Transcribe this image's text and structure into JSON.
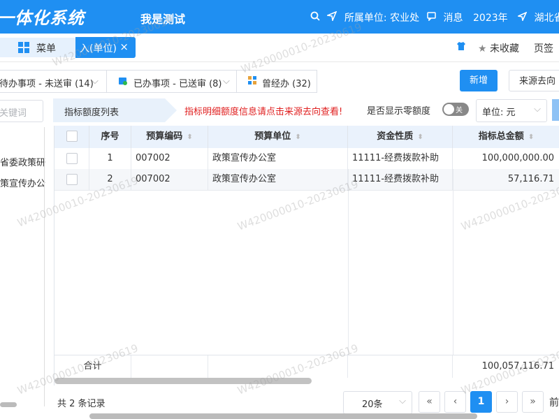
{
  "header": {
    "title": "一体化系统",
    "user_name": "我是测试",
    "unit_label": "所属单位: 农业处",
    "messages": "消息",
    "year": "2023年",
    "region": "湖北省"
  },
  "tabbar": {
    "menu_label": "菜单",
    "active_tab_label": "入(单位)",
    "close_icon": "×",
    "favorite_label": "未收藏",
    "page_sign": "页签"
  },
  "filters": {
    "tabs": [
      {
        "label": "待办事项 - 未送审 (14)"
      },
      {
        "label": "已办事项 - 已送审 (8)"
      },
      {
        "label": "曾经办 (32)"
      }
    ],
    "new_button": "新增",
    "source_button": "来源去向"
  },
  "left_panel": {
    "search_placeholder": "关键词",
    "tree_items": [
      "省委政策研",
      "策宣传办公"
    ]
  },
  "toolbar": {
    "list_title": "指标额度列表",
    "tip": "指标明细额度信息请点击来源去向查看!",
    "zero_label": "是否显示零额度",
    "toggle_text": "关",
    "unit_label": "单位:",
    "unit_value": "元"
  },
  "table": {
    "columns": [
      "序号",
      "预算编码",
      "预算单位",
      "资金性质",
      "指标总金额"
    ],
    "rows": [
      {
        "no": "1",
        "code": "007002",
        "unit": "政策宣传办公室",
        "fund": "11111-经费拨款补助",
        "amount": "100,000,000.00"
      },
      {
        "no": "2",
        "code": "007002",
        "unit": "政策宣传办公室",
        "fund": "11111-经费拨款补助",
        "amount": "57,116.71"
      }
    ],
    "sum_label": "合计",
    "sum_amount": "100,057,116.71"
  },
  "pagination": {
    "total": "共 2 条记录",
    "page_size": "20条",
    "current_page": "1",
    "first": "«",
    "prev": "‹",
    "next": "›",
    "last": "»",
    "goto": "前往"
  },
  "watermark": "W420000010-20230619",
  "colors": {
    "primary": "#1f8ff2",
    "tip_red": "#e02020",
    "header_bg": "#eaf2fc"
  }
}
